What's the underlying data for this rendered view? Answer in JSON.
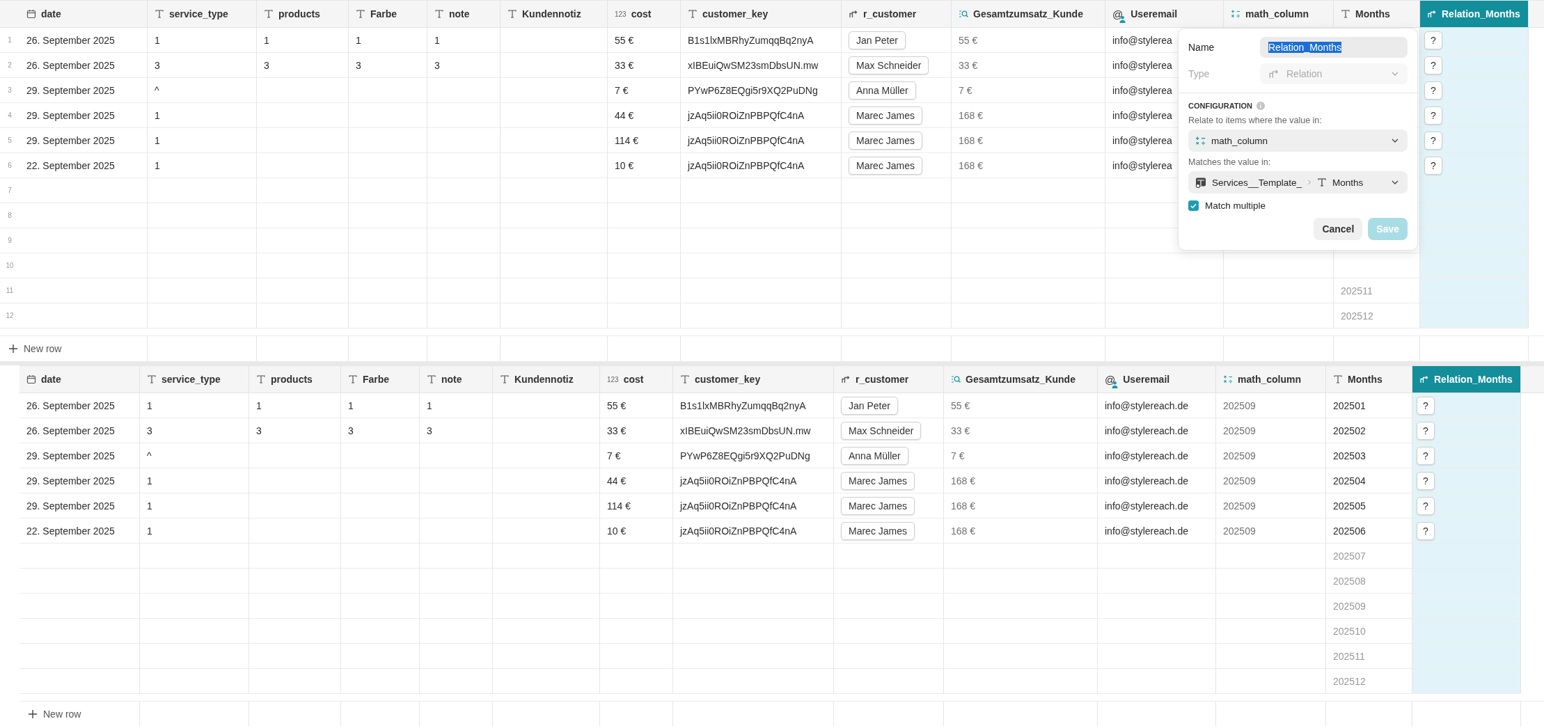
{
  "tables": [
    {
      "new_row_label": "New row",
      "columns": [
        {
          "label": "date",
          "kind": "date",
          "selected": false
        },
        {
          "label": "service_type",
          "kind": "text",
          "selected": false
        },
        {
          "label": "products",
          "kind": "text",
          "selected": false
        },
        {
          "label": "Farbe",
          "kind": "text",
          "selected": false
        },
        {
          "label": "note",
          "kind": "text",
          "selected": false
        },
        {
          "label": "Kundennotiz",
          "kind": "text",
          "selected": false
        },
        {
          "label": "cost",
          "kind": "number",
          "icon_text": "123",
          "selected": false
        },
        {
          "label": "customer_key",
          "kind": "text",
          "selected": false
        },
        {
          "label": "r_customer",
          "kind": "relation",
          "selected": false
        },
        {
          "label": "Gesamtzumsatz_Kunde",
          "kind": "lookup",
          "selected": false
        },
        {
          "label": "Useremail",
          "kind": "user",
          "icon_text": "@",
          "selected": false
        },
        {
          "label": "math_column",
          "kind": "math",
          "selected": false
        },
        {
          "label": "Months",
          "kind": "text",
          "selected": false
        },
        {
          "label": "Relation_Months",
          "kind": "relation",
          "selected": true
        }
      ],
      "rows": [
        {
          "number": "1",
          "dimmed": false,
          "cells": [
            "26. September 2025",
            "1",
            "1",
            "1",
            "1",
            null,
            "55 €",
            "B1s1lxMBRhyZumqqBq2nyA",
            "Jan Peter",
            "55 €",
            "info@stylerea",
            null,
            null,
            "?"
          ]
        },
        {
          "number": "2",
          "dimmed": false,
          "cells": [
            "26. September 2025",
            "3",
            "3",
            "3",
            "3",
            null,
            "33 €",
            "xIBEuiQwSM23smDbsUN.mw",
            "Max Schneider",
            "33 €",
            "info@stylerea",
            null,
            null,
            "?"
          ]
        },
        {
          "number": "3",
          "dimmed": false,
          "cells": [
            "29. September 2025",
            "^",
            null,
            null,
            null,
            null,
            "7 €",
            "PYwP6Z8EQgi5r9XQ2PuDNg",
            "Anna Müller",
            "7 €",
            "info@stylerea",
            null,
            null,
            "?"
          ]
        },
        {
          "number": "4",
          "dimmed": false,
          "cells": [
            "29. September 2025",
            "1",
            null,
            null,
            null,
            null,
            "44 €",
            "jzAq5ii0ROiZnPBPQfC4nA",
            "Marec James",
            "168 €",
            "info@stylerea",
            null,
            null,
            "?"
          ]
        },
        {
          "number": "5",
          "dimmed": false,
          "cells": [
            "29. September 2025",
            "1",
            null,
            null,
            null,
            null,
            "114 €",
            "jzAq5ii0ROiZnPBPQfC4nA",
            "Marec James",
            "168 €",
            "info@stylerea",
            null,
            null,
            "?"
          ]
        },
        {
          "number": "6",
          "dimmed": false,
          "cells": [
            "22. September 2025",
            "1",
            null,
            null,
            null,
            null,
            "10 €",
            "jzAq5ii0ROiZnPBPQfC4nA",
            "Marec James",
            "168 €",
            "info@stylerea",
            null,
            null,
            "?"
          ]
        },
        {
          "number": "7",
          "dimmed": true,
          "cells": [
            null,
            null,
            null,
            null,
            null,
            null,
            null,
            null,
            null,
            null,
            null,
            null,
            null,
            null
          ]
        },
        {
          "number": "8",
          "dimmed": true,
          "cells": [
            null,
            null,
            null,
            null,
            null,
            null,
            null,
            null,
            null,
            null,
            null,
            null,
            null,
            null
          ]
        },
        {
          "number": "9",
          "dimmed": true,
          "cells": [
            null,
            null,
            null,
            null,
            null,
            null,
            null,
            null,
            null,
            null,
            null,
            null,
            null,
            null
          ]
        },
        {
          "number": "10",
          "dimmed": true,
          "cells": [
            null,
            null,
            null,
            null,
            null,
            null,
            null,
            null,
            null,
            null,
            null,
            null,
            null,
            null
          ]
        },
        {
          "number": "11",
          "dimmed": true,
          "cells": [
            null,
            null,
            null,
            null,
            null,
            null,
            null,
            null,
            null,
            null,
            null,
            null,
            "202511",
            null
          ]
        },
        {
          "number": "12",
          "dimmed": true,
          "cells": [
            null,
            null,
            null,
            null,
            null,
            null,
            null,
            null,
            null,
            null,
            null,
            null,
            "202512",
            null
          ]
        }
      ],
      "field_dialog": {
        "name_label": "Name",
        "name_value": "Relation_Months",
        "type_label": "Type",
        "type_value": "Relation",
        "type_disabled": true,
        "section_title": "CONFIGURATION",
        "relate_label": "Relate to items where the value in:",
        "relate_value": "math_column",
        "matches_label": "Matches the value in:",
        "matches_table": "Services__Template_",
        "matches_column": "Months",
        "match_multiple": {
          "label": "Match multiple",
          "checked": true
        },
        "buttons": [
          {
            "label": "Cancel",
            "kind": "secondary",
            "disabled": false
          },
          {
            "label": "Save",
            "kind": "primary",
            "disabled": true
          }
        ]
      }
    },
    {
      "new_row_label": "New row",
      "columns": [
        {
          "label": "date",
          "kind": "date",
          "selected": false
        },
        {
          "label": "service_type",
          "kind": "text",
          "selected": false
        },
        {
          "label": "products",
          "kind": "text",
          "selected": false
        },
        {
          "label": "Farbe",
          "kind": "text",
          "selected": false
        },
        {
          "label": "note",
          "kind": "text",
          "selected": false
        },
        {
          "label": "Kundennotiz",
          "kind": "text",
          "selected": false
        },
        {
          "label": "cost",
          "kind": "number",
          "icon_text": "123",
          "selected": false
        },
        {
          "label": "customer_key",
          "kind": "text",
          "selected": false
        },
        {
          "label": "r_customer",
          "kind": "relation",
          "selected": false
        },
        {
          "label": "Gesamtzumsatz_Kunde",
          "kind": "lookup",
          "selected": false
        },
        {
          "label": "Useremail",
          "kind": "user",
          "icon_text": "@",
          "selected": false
        },
        {
          "label": "math_column",
          "kind": "math",
          "selected": false
        },
        {
          "label": "Months",
          "kind": "text",
          "selected": false
        },
        {
          "label": "Relation_Months",
          "kind": "relation",
          "selected": true
        }
      ],
      "rows": [
        {
          "dimmed": false,
          "cells": [
            "26. September 2025",
            "1",
            "1",
            "1",
            "1",
            null,
            "55 €",
            "B1s1lxMBRhyZumqqBq2nyA",
            "Jan Peter",
            "55 €",
            "info@stylereach.de",
            "202509",
            "202501",
            "?"
          ]
        },
        {
          "dimmed": false,
          "cells": [
            "26. September 2025",
            "3",
            "3",
            "3",
            "3",
            null,
            "33 €",
            "xIBEuiQwSM23smDbsUN.mw",
            "Max Schneider",
            "33 €",
            "info@stylereach.de",
            "202509",
            "202502",
            "?"
          ]
        },
        {
          "dimmed": false,
          "cells": [
            "29. September 2025",
            "^",
            null,
            null,
            null,
            null,
            "7 €",
            "PYwP6Z8EQgi5r9XQ2PuDNg",
            "Anna Müller",
            "7 €",
            "info@stylereach.de",
            "202509",
            "202503",
            "?"
          ]
        },
        {
          "dimmed": false,
          "cells": [
            "29. September 2025",
            "1",
            null,
            null,
            null,
            null,
            "44 €",
            "jzAq5ii0ROiZnPBPQfC4nA",
            "Marec James",
            "168 €",
            "info@stylereach.de",
            "202509",
            "202504",
            "?"
          ]
        },
        {
          "dimmed": false,
          "cells": [
            "29. September 2025",
            "1",
            null,
            null,
            null,
            null,
            "114 €",
            "jzAq5ii0ROiZnPBPQfC4nA",
            "Marec James",
            "168 €",
            "info@stylereach.de",
            "202509",
            "202505",
            "?"
          ]
        },
        {
          "dimmed": false,
          "cells": [
            "22. September 2025",
            "1",
            null,
            null,
            null,
            null,
            "10 €",
            "jzAq5ii0ROiZnPBPQfC4nA",
            "Marec James",
            "168 €",
            "info@stylereach.de",
            "202509",
            "202506",
            "?"
          ]
        },
        {
          "dimmed": true,
          "cells": [
            null,
            null,
            null,
            null,
            null,
            null,
            null,
            null,
            null,
            null,
            null,
            null,
            "202507",
            null
          ]
        },
        {
          "dimmed": true,
          "cells": [
            null,
            null,
            null,
            null,
            null,
            null,
            null,
            null,
            null,
            null,
            null,
            null,
            "202508",
            null
          ]
        },
        {
          "dimmed": true,
          "cells": [
            null,
            null,
            null,
            null,
            null,
            null,
            null,
            null,
            null,
            null,
            null,
            null,
            "202509",
            null
          ]
        },
        {
          "dimmed": true,
          "cells": [
            null,
            null,
            null,
            null,
            null,
            null,
            null,
            null,
            null,
            null,
            null,
            null,
            "202510",
            null
          ]
        },
        {
          "dimmed": true,
          "cells": [
            null,
            null,
            null,
            null,
            null,
            null,
            null,
            null,
            null,
            null,
            null,
            null,
            "202511",
            null
          ]
        },
        {
          "dimmed": true,
          "cells": [
            null,
            null,
            null,
            null,
            null,
            null,
            null,
            null,
            null,
            null,
            null,
            null,
            "202512",
            null
          ]
        }
      ]
    }
  ]
}
